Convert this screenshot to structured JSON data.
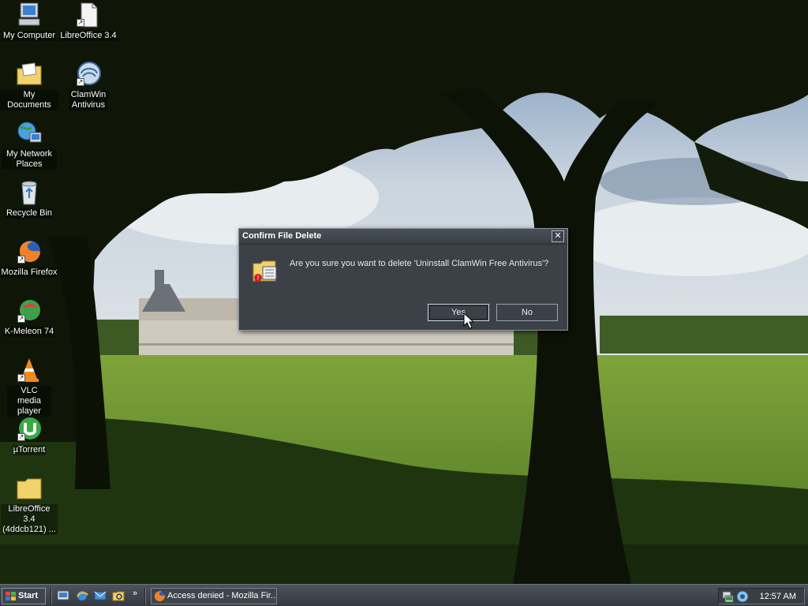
{
  "desktop": {
    "icons": [
      {
        "name": "my-computer",
        "label": "My Computer"
      },
      {
        "name": "libreoffice",
        "label": "LibreOffice 3.4"
      },
      {
        "name": "my-documents",
        "label": "My Documents"
      },
      {
        "name": "clamwin",
        "label": "ClamWin Antivirus"
      },
      {
        "name": "network-places",
        "label": "My Network Places"
      },
      {
        "name": "recycle-bin",
        "label": "Recycle Bin"
      },
      {
        "name": "firefox",
        "label": "Mozilla Firefox"
      },
      {
        "name": "kmeleon",
        "label": "K-Meleon 74"
      },
      {
        "name": "vlc",
        "label": "VLC media player"
      },
      {
        "name": "utorrent",
        "label": "µTorrent"
      },
      {
        "name": "libreoffice-folder",
        "label": "LibreOffice 3.4 (4ddcb121) ..."
      }
    ]
  },
  "dialog": {
    "title": "Confirm File Delete",
    "close_label": "✕",
    "message": "Are you sure you want to delete 'Uninstall ClamWin Free Antivirus'?",
    "yes_label": "Yes",
    "no_label": "No"
  },
  "taskbar": {
    "start_label": "Start",
    "more_label": "»",
    "task_label": "Access denied - Mozilla Fir...",
    "clock": "12:57 AM"
  }
}
